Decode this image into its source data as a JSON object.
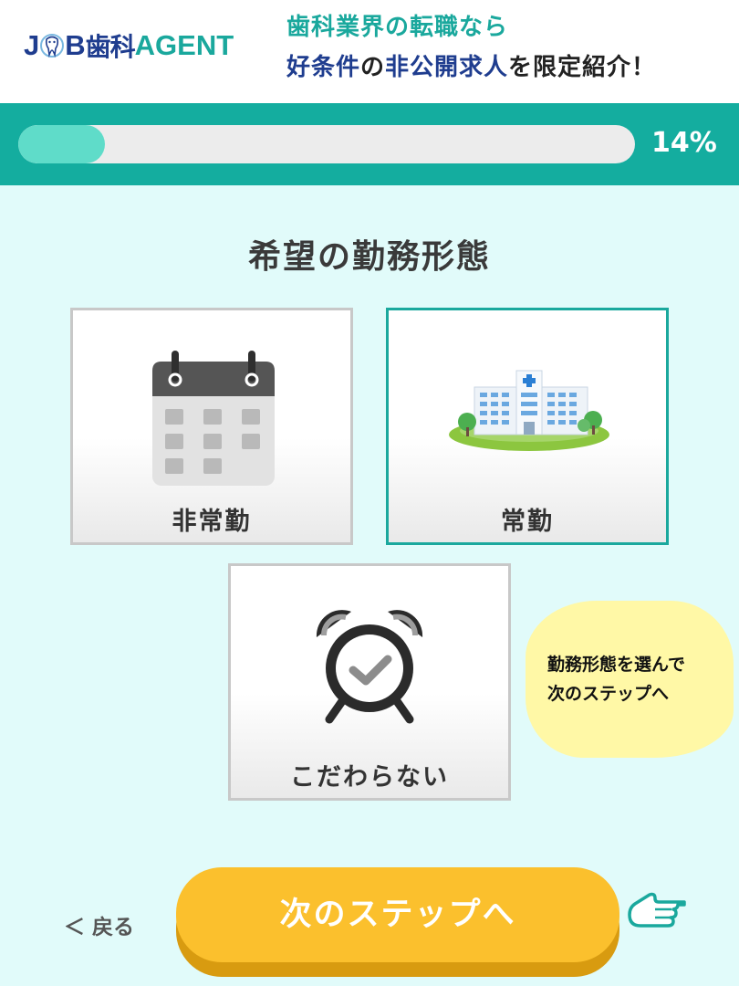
{
  "header": {
    "logo": {
      "job_j": "J",
      "job_b": "B",
      "shika": "歯科",
      "agent": "AGENT"
    },
    "tagline_line1": "歯科業界の転職なら",
    "tagline_line2_a": "好条件",
    "tagline_line2_b": "の",
    "tagline_line2_c": "非公開求人",
    "tagline_line2_d": "を限定紹介！"
  },
  "progress": {
    "percent_label": "14%",
    "fraction": 0.14
  },
  "question": {
    "title": "希望の勤務形態"
  },
  "options": [
    {
      "label": "非常勤",
      "icon": "calendar-icon",
      "selected": false
    },
    {
      "label": "常勤",
      "icon": "hospital-building-icon",
      "selected": true
    },
    {
      "label": "こだわらない",
      "icon": "alarm-clock-icon",
      "selected": false
    }
  ],
  "hint_bubble": {
    "line1": "勤務形態を選んで",
    "line2": "次のステップへ"
  },
  "nav": {
    "back_label": "＜ 戻る",
    "next_label": "次のステップへ"
  },
  "colors": {
    "accent": "#1aa89d",
    "brand_blue": "#1f3d8f",
    "button": "#fbc02d",
    "background": "#e1fbfa"
  }
}
